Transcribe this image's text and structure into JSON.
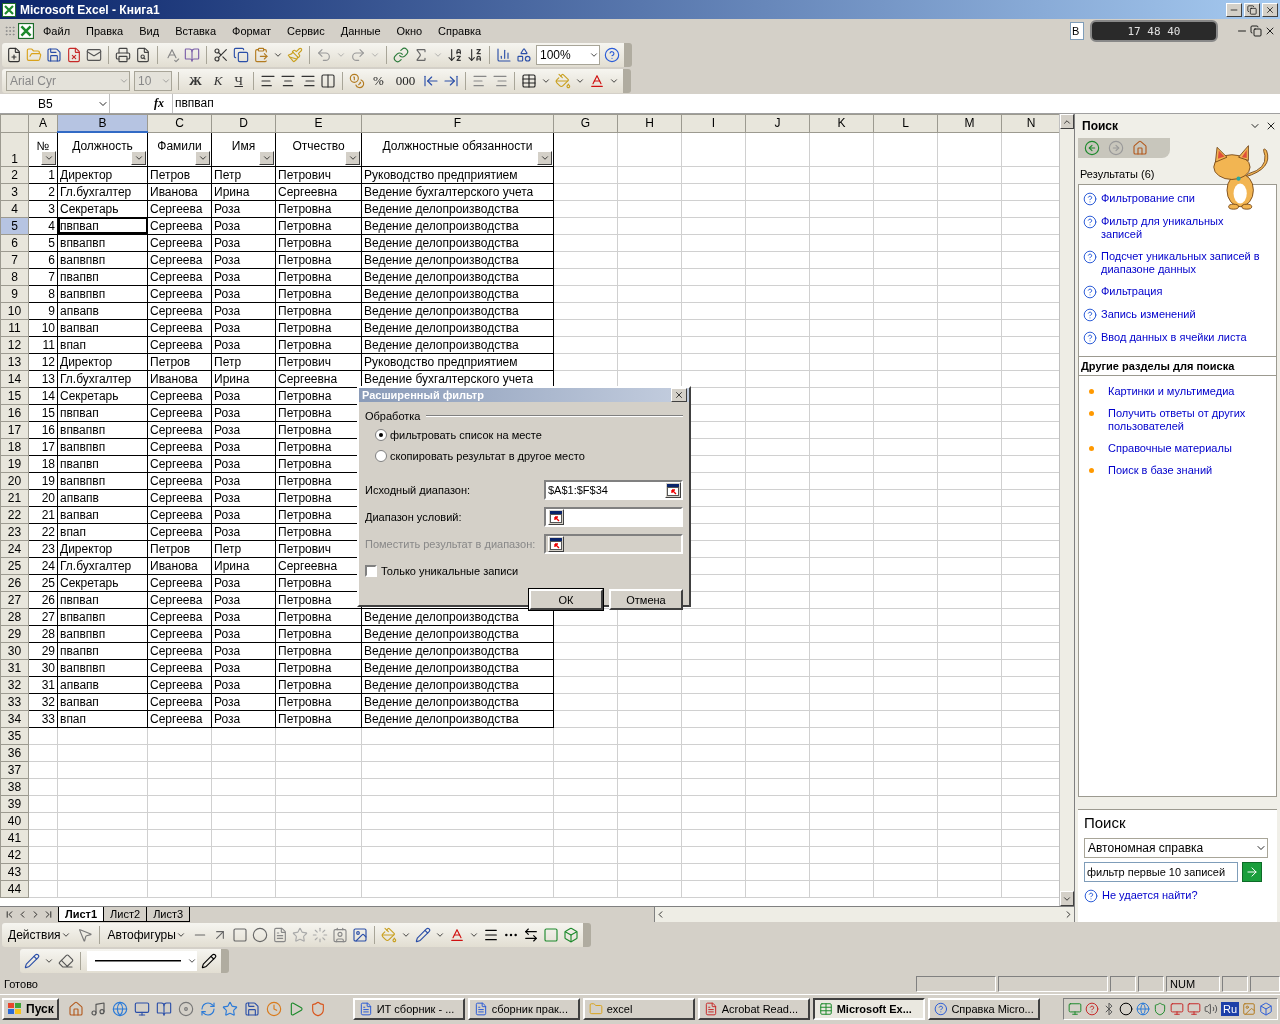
{
  "window": {
    "title": "Microsoft Excel - Книга1"
  },
  "menu": [
    "Файл",
    "Правка",
    "Вид",
    "Вставка",
    "Формат",
    "Сервис",
    "Данные",
    "Окно",
    "Справка"
  ],
  "help_box": "В",
  "meter": "17 48 40",
  "standard_toolbar": {
    "zoom": "100%"
  },
  "formatting_toolbar": {
    "font": "Arial Cyr",
    "size": "10",
    "style_buttons": [
      "Ж",
      "К",
      "Ч"
    ],
    "number_buttons": [
      "%",
      "000"
    ]
  },
  "formula_bar": {
    "name_box": "B5",
    "fx": "fx",
    "value": "пвпвап"
  },
  "sheet": {
    "autofilter": true,
    "columns": [
      {
        "label": "A",
        "selected": false
      },
      {
        "label": "B",
        "selected": true
      },
      {
        "label": "C",
        "selected": false
      },
      {
        "label": "D",
        "selected": false
      },
      {
        "label": "E",
        "selected": false
      },
      {
        "label": "F",
        "selected": false
      },
      {
        "label": "G",
        "selected": false
      },
      {
        "label": "H",
        "selected": false
      },
      {
        "label": "I",
        "selected": false
      },
      {
        "label": "J",
        "selected": false
      },
      {
        "label": "K",
        "selected": false
      },
      {
        "label": "L",
        "selected": false
      },
      {
        "label": "M",
        "selected": false
      },
      {
        "label": "N",
        "selected": false
      }
    ],
    "header_row": {
      "label": "1",
      "cells": [
        "№",
        "Должность",
        "Фамили",
        "Имя",
        "Отчество",
        "Должностные обязанности"
      ]
    },
    "rows": [
      {
        "label": "2",
        "selected": false,
        "cells": [
          "1",
          "Директор",
          "Петров",
          "Петр",
          "Петрович",
          "Руководство предприятием"
        ]
      },
      {
        "label": "3",
        "selected": false,
        "cells": [
          "2",
          "Гл.бухгалтер",
          "Иванова",
          "Ирина",
          "Сергеевна",
          "Ведение бухгалтерского учета"
        ]
      },
      {
        "label": "4",
        "selected": false,
        "cells": [
          "3",
          "Секретарь",
          "Сергеева",
          "Роза",
          "Петровна",
          "Ведение делопроизводства"
        ]
      },
      {
        "label": "5",
        "selected": true,
        "cells": [
          "4",
          "пвпвап",
          "Сергеева",
          "Роза",
          "Петровна",
          "Ведение делопроизводства"
        ]
      },
      {
        "label": "6",
        "selected": false,
        "cells": [
          "5",
          "впвапвп",
          "Сергеева",
          "Роза",
          "Петровна",
          "Ведение делопроизводства"
        ]
      },
      {
        "label": "7",
        "selected": false,
        "cells": [
          "6",
          "вапвпвп",
          "Сергеева",
          "Роза",
          "Петровна",
          "Ведение делопроизводства"
        ]
      },
      {
        "label": "8",
        "selected": false,
        "cells": [
          "7",
          "пвапвп",
          "Сергеева",
          "Роза",
          "Петровна",
          "Ведение делопроизводства"
        ]
      },
      {
        "label": "9",
        "selected": false,
        "cells": [
          "8",
          "вапвпвп",
          "Сергеева",
          "Роза",
          "Петровна",
          "Ведение делопроизводства"
        ]
      },
      {
        "label": "10",
        "selected": false,
        "cells": [
          "9",
          "апвапв",
          "Сергеева",
          "Роза",
          "Петровна",
          "Ведение делопроизводства"
        ]
      },
      {
        "label": "11",
        "selected": false,
        "cells": [
          "10",
          "вапвап",
          "Сергеева",
          "Роза",
          "Петровна",
          "Ведение делопроизводства"
        ]
      },
      {
        "label": "12",
        "selected": false,
        "cells": [
          "11",
          "впап",
          "Сергеева",
          "Роза",
          "Петровна",
          "Ведение делопроизводства"
        ]
      },
      {
        "label": "13",
        "selected": false,
        "cells": [
          "12",
          "Директор",
          "Петров",
          "Петр",
          "Петрович",
          "Руководство предприятием"
        ]
      },
      {
        "label": "14",
        "selected": false,
        "cells": [
          "13",
          "Гл.бухгалтер",
          "Иванова",
          "Ирина",
          "Сергеевна",
          "Ведение бухгалтерского учета"
        ]
      },
      {
        "label": "15",
        "selected": false,
        "cells": [
          "14",
          "Секретарь",
          "Сергеева",
          "Роза",
          "Петровна"
        ]
      },
      {
        "label": "16",
        "selected": false,
        "cells": [
          "15",
          "пвпвап",
          "Сергеева",
          "Роза",
          "Петровна"
        ]
      },
      {
        "label": "17",
        "selected": false,
        "cells": [
          "16",
          "впвапвп",
          "Сергеева",
          "Роза",
          "Петровна"
        ]
      },
      {
        "label": "18",
        "selected": false,
        "cells": [
          "17",
          "вапвпвп",
          "Сергеева",
          "Роза",
          "Петровна"
        ]
      },
      {
        "label": "19",
        "selected": false,
        "cells": [
          "18",
          "пвапвп",
          "Сергеева",
          "Роза",
          "Петровна"
        ]
      },
      {
        "label": "20",
        "selected": false,
        "cells": [
          "19",
          "вапвпвп",
          "Сергеева",
          "Роза",
          "Петровна"
        ]
      },
      {
        "label": "21",
        "selected": false,
        "cells": [
          "20",
          "апвапв",
          "Сергеева",
          "Роза",
          "Петровна"
        ]
      },
      {
        "label": "22",
        "selected": false,
        "cells": [
          "21",
          "вапвап",
          "Сергеева",
          "Роза",
          "Петровна"
        ]
      },
      {
        "label": "23",
        "selected": false,
        "cells": [
          "22",
          "впап",
          "Сергеева",
          "Роза",
          "Петровна"
        ]
      },
      {
        "label": "24",
        "selected": false,
        "cells": [
          "23",
          "Директор",
          "Петров",
          "Петр",
          "Петрович"
        ]
      },
      {
        "label": "25",
        "selected": false,
        "cells": [
          "24",
          "Гл.бухгалтер",
          "Иванова",
          "Ирина",
          "Сергеевна"
        ]
      },
      {
        "label": "26",
        "selected": false,
        "cells": [
          "25",
          "Секретарь",
          "Сергеева",
          "Роза",
          "Петровна"
        ]
      },
      {
        "label": "27",
        "selected": false,
        "cells": [
          "26",
          "пвпвап",
          "Сергеева",
          "Роза",
          "Петровна"
        ]
      },
      {
        "label": "28",
        "selected": false,
        "cells": [
          "27",
          "впвапвп",
          "Сергеева",
          "Роза",
          "Петровна",
          "Ведение делопроизводства"
        ]
      },
      {
        "label": "29",
        "selected": false,
        "cells": [
          "28",
          "вапвпвп",
          "Сергеева",
          "Роза",
          "Петровна",
          "Ведение делопроизводства"
        ]
      },
      {
        "label": "30",
        "selected": false,
        "cells": [
          "29",
          "пвапвп",
          "Сергеева",
          "Роза",
          "Петровна",
          "Ведение делопроизводства"
        ]
      },
      {
        "label": "31",
        "selected": false,
        "cells": [
          "30",
          "вапвпвп",
          "Сергеева",
          "Роза",
          "Петровна",
          "Ведение делопроизводства"
        ]
      },
      {
        "label": "32",
        "selected": false,
        "cells": [
          "31",
          "апвапв",
          "Сергеева",
          "Роза",
          "Петровна",
          "Ведение делопроизводства"
        ]
      },
      {
        "label": "33",
        "selected": false,
        "cells": [
          "32",
          "вапвап",
          "Сергеева",
          "Роза",
          "Петровна",
          "Ведение делопроизводства"
        ]
      },
      {
        "label": "34",
        "selected": false,
        "cells": [
          "33",
          "впап",
          "Сергеева",
          "Роза",
          "Петровна",
          "Ведение делопроизводства"
        ]
      },
      {
        "label": "35",
        "selected": false
      },
      {
        "label": "36",
        "selected": false
      },
      {
        "label": "37",
        "selected": false
      },
      {
        "label": "38",
        "selected": false
      },
      {
        "label": "39",
        "selected": false
      },
      {
        "label": "40",
        "selected": false
      },
      {
        "label": "41",
        "selected": false
      },
      {
        "label": "42",
        "selected": false
      },
      {
        "label": "43",
        "selected": false
      },
      {
        "label": "44",
        "selected": false
      }
    ]
  },
  "sheet_tabs": [
    {
      "label": "Лист1",
      "selected": true
    },
    {
      "label": "Лист2",
      "selected": false
    },
    {
      "label": "Лист3",
      "selected": false
    }
  ],
  "dialog": {
    "title": "Расширенный фильтр",
    "group": "Обработка",
    "modes": [
      {
        "label": "фильтровать список на месте",
        "selected": true
      },
      {
        "label": "скопировать результат в другое место",
        "selected": false
      }
    ],
    "fields": [
      {
        "label": "Исходный диапазон:",
        "value": "$A$1:$F$34",
        "disabled": false
      },
      {
        "label": "Диапазон условий:",
        "disabled": false
      },
      {
        "label": "Поместить результат в диапазон:",
        "disabled": true
      }
    ],
    "unique_only": {
      "label": "Только уникальные записи",
      "checked": false
    },
    "buttons": [
      "ОК",
      "Отмена"
    ]
  },
  "task_pane": {
    "title": "Поиск",
    "results_label": "Результаты (6)",
    "results": [
      "Фильтрование спи",
      "Фильтр для уникальных записей",
      "Подсчет уникальных записей в диапазоне данных",
      "Фильтрация",
      "Запись изменений",
      "Ввод данных в ячейки листа"
    ],
    "other_heading": "Другие разделы для поиска",
    "other_links": [
      "Картинки и мультимедиа",
      "Получить ответы от других пользователей",
      "Справочные материалы",
      "Поиск в базе знаний"
    ],
    "search": {
      "heading": "Поиск",
      "scope": "Автономная справка",
      "query": "фильтр первые 10 записей",
      "help_link": "Не удается найти?"
    }
  },
  "drawing_toolbar": {
    "actions": "Действия",
    "autoshapes": "Автофигуры"
  },
  "status_bar": {
    "text": "Готово",
    "indicators": [
      "NUM"
    ]
  },
  "taskbar": {
    "start": "Пуск",
    "tasks": [
      {
        "label": "ИТ сборник - ...",
        "kind": "document",
        "selected": false
      },
      {
        "label": "сборник прак...",
        "kind": "document",
        "selected": false
      },
      {
        "label": "excel",
        "kind": "folder",
        "selected": false
      },
      {
        "label": "Acrobat Read...",
        "kind": "pdf",
        "selected": false
      },
      {
        "label": "Microsoft Ex...",
        "kind": "sheet",
        "selected": true
      },
      {
        "label": "Справка Micro...",
        "kind": "help",
        "selected": false
      }
    ],
    "language": "Ru"
  }
}
